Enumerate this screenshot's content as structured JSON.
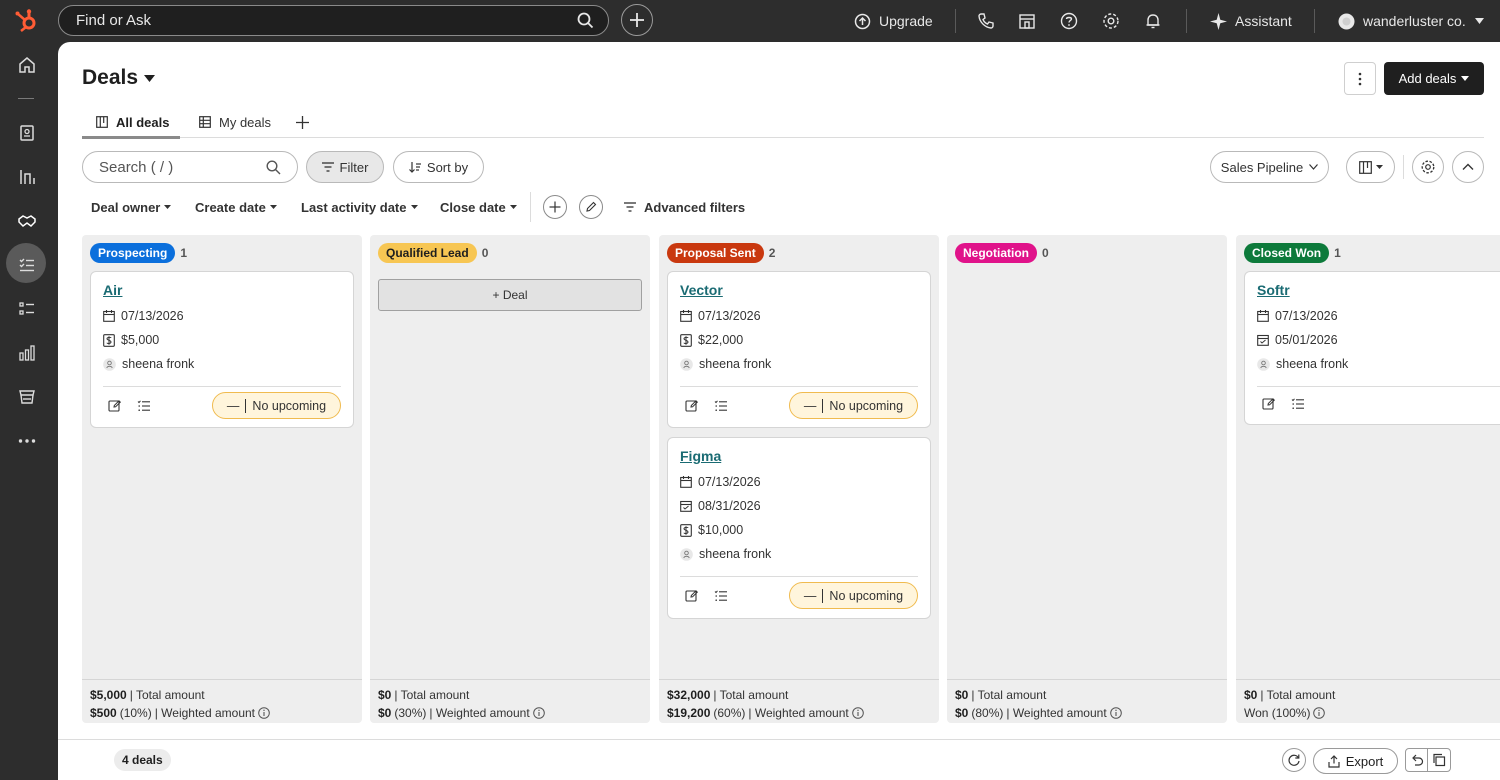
{
  "topbar": {
    "search_placeholder": "Find or Ask",
    "upgrade_label": "Upgrade",
    "assistant_label": "Assistant",
    "account_name": "wanderluster co."
  },
  "page": {
    "title": "Deals",
    "add_deals_label": "Add deals",
    "tabs": [
      {
        "label": "All deals",
        "active": true
      },
      {
        "label": "My deals",
        "active": false
      }
    ]
  },
  "toolbar": {
    "search_placeholder": "Search ( / )",
    "filter_label": "Filter",
    "sort_label": "Sort by",
    "pipeline_label": "Sales Pipeline",
    "filters": [
      "Deal owner",
      "Create date",
      "Last activity date",
      "Close date"
    ],
    "advanced_filters_label": "Advanced filters"
  },
  "board": {
    "columns": [
      {
        "stage": "Prospecting",
        "count": "1",
        "color": "#0b6fdc",
        "text_color": "#ffffff",
        "total": "$5,000",
        "total_label": "| Total amount",
        "weighted": "$500",
        "weighted_pct": "(10%)",
        "weighted_label": "| Weighted amount",
        "cards": [
          {
            "name": "Air",
            "create_date": "07/13/2026",
            "amount": "$5,000",
            "owner": "sheena fronk",
            "activity": "No upcoming"
          }
        ]
      },
      {
        "stage": "Qualified Lead",
        "count": "0",
        "color": "#f7c653",
        "text_color": "#1f1f1f",
        "total": "$0",
        "total_label": "| Total amount",
        "weighted": "$0",
        "weighted_pct": "(30%)",
        "weighted_label": "| Weighted amount",
        "add_deal_label": "+ Deal",
        "cards": []
      },
      {
        "stage": "Proposal Sent",
        "count": "2",
        "color": "#c9380f",
        "text_color": "#ffffff",
        "total": "$32,000",
        "total_label": "| Total amount",
        "weighted": "$19,200",
        "weighted_pct": "(60%)",
        "weighted_label": "| Weighted amount",
        "cards": [
          {
            "name": "Vector",
            "create_date": "07/13/2026",
            "amount": "$22,000",
            "owner": "sheena fronk",
            "activity": "No upcoming"
          },
          {
            "name": "Figma",
            "create_date": "07/13/2026",
            "close_date": "08/31/2026",
            "amount": "$10,000",
            "owner": "sheena fronk",
            "activity": "No upcoming"
          }
        ]
      },
      {
        "stage": "Negotiation",
        "count": "0",
        "color": "#e0138a",
        "text_color": "#ffffff",
        "total": "$0",
        "total_label": "| Total amount",
        "weighted": "$0",
        "weighted_pct": "(80%)",
        "weighted_label": "| Weighted amount",
        "cards": []
      },
      {
        "stage": "Closed Won",
        "count": "1",
        "color": "#0d7a3b",
        "text_color": "#ffffff",
        "total": "$0",
        "total_label": "| Total amount",
        "weighted_won": "Won (100%)",
        "cards": [
          {
            "name": "Softr",
            "create_date": "07/13/2026",
            "close_date": "05/01/2026",
            "owner": "sheena fronk"
          }
        ]
      }
    ]
  },
  "footer": {
    "deal_count": "4 deals",
    "export_label": "Export"
  },
  "icons": {
    "logo": "hubspot-sprocket-icon",
    "calendar": "calendar-icon",
    "dollar": "dollar-icon",
    "person": "person-icon",
    "info": "info-icon"
  },
  "colors": {
    "brand_orange": "#ff5c35",
    "link_teal": "#1a6b73",
    "activity_border": "#f0bb4f"
  }
}
